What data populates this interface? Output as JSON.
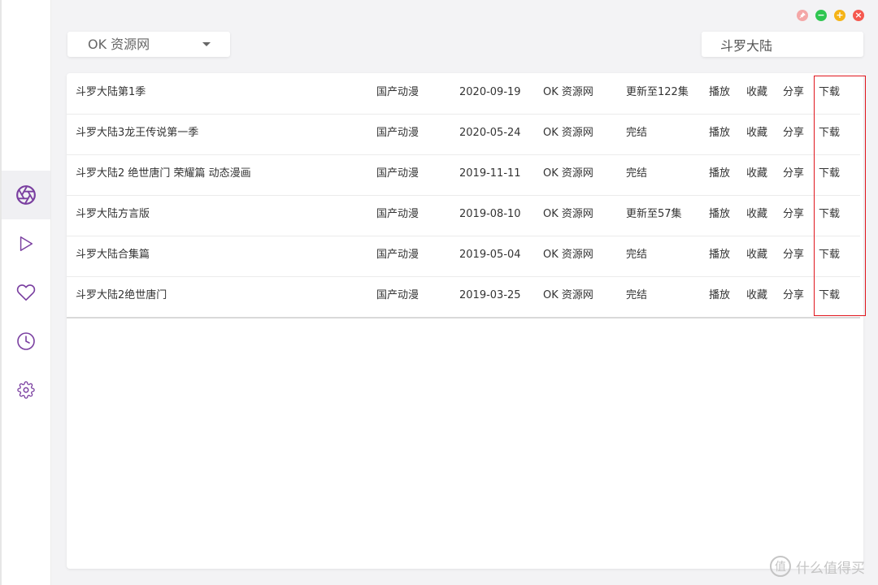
{
  "window": {
    "controls": {
      "pin": "",
      "minimize": "−",
      "maximize": "+",
      "close": "×"
    }
  },
  "sidebar": {
    "items": [
      {
        "name": "explore",
        "icon": "aperture-icon",
        "active": true
      },
      {
        "name": "play",
        "icon": "play-icon",
        "active": false
      },
      {
        "name": "favorites",
        "icon": "heart-icon",
        "active": false
      },
      {
        "name": "history",
        "icon": "clock-icon",
        "active": false
      },
      {
        "name": "settings",
        "icon": "gear-icon",
        "active": false
      }
    ]
  },
  "toolbar": {
    "source_select": {
      "value": "OK 资源网",
      "icon": "chevron-down-icon"
    },
    "search": {
      "value": "斗罗大陆",
      "placeholder": ""
    }
  },
  "table": {
    "rows": [
      {
        "title": "斗罗大陆第1季",
        "type": "国产动漫",
        "date": "2020-09-19",
        "source": "OK 资源网",
        "status": "更新至122集",
        "play": "播放",
        "favorite": "收藏",
        "share": "分享",
        "download": "下载"
      },
      {
        "title": "斗罗大陆3龙王传说第一季",
        "type": "国产动漫",
        "date": "2020-05-24",
        "source": "OK 资源网",
        "status": "完结",
        "play": "播放",
        "favorite": "收藏",
        "share": "分享",
        "download": "下载"
      },
      {
        "title": "斗罗大陆2 绝世唐门 荣耀篇 动态漫画",
        "type": "国产动漫",
        "date": "2019-11-11",
        "source": "OK 资源网",
        "status": "完结",
        "play": "播放",
        "favorite": "收藏",
        "share": "分享",
        "download": "下载"
      },
      {
        "title": "斗罗大陆方言版",
        "type": "国产动漫",
        "date": "2019-08-10",
        "source": "OK 资源网",
        "status": "更新至57集",
        "play": "播放",
        "favorite": "收藏",
        "share": "分享",
        "download": "下载"
      },
      {
        "title": "斗罗大陆合集篇",
        "type": "国产动漫",
        "date": "2019-05-04",
        "source": "OK 资源网",
        "status": "完结",
        "play": "播放",
        "favorite": "收藏",
        "share": "分享",
        "download": "下载"
      },
      {
        "title": "斗罗大陆2绝世唐门",
        "type": "国产动漫",
        "date": "2019-03-25",
        "source": "OK 资源网",
        "status": "完结",
        "play": "播放",
        "favorite": "收藏",
        "share": "分享",
        "download": "下载"
      }
    ]
  },
  "watermark": {
    "badge": "值",
    "text": "什么值得买"
  },
  "colors": {
    "accent": "#7a3fa0",
    "highlight": "#e0161d",
    "background": "#f3f3f5"
  }
}
